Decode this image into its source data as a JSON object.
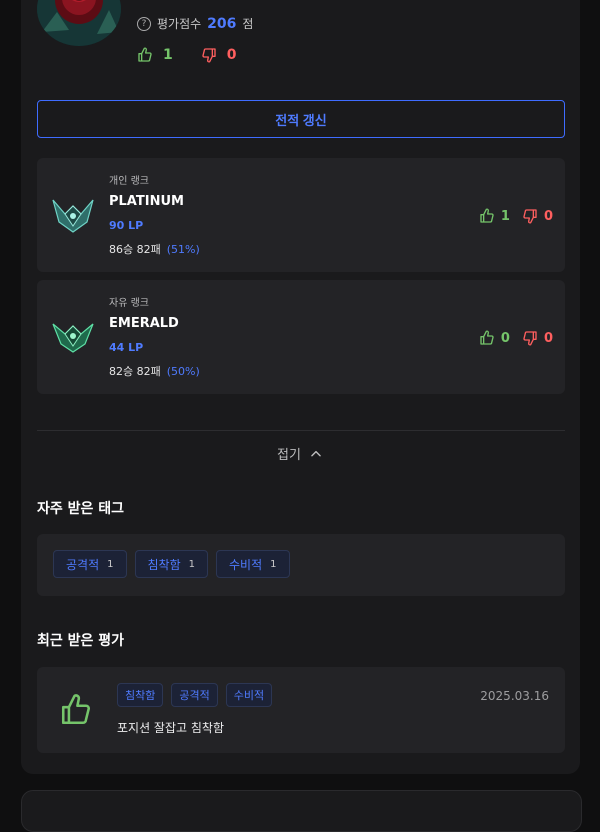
{
  "profile": {
    "score_label": "평가점수",
    "score_value": "206",
    "score_unit": "점",
    "likes": "1",
    "dislikes": "0"
  },
  "refresh_button": "전적 갱신",
  "ranks": [
    {
      "queue": "개인 랭크",
      "tier": "PLATINUM",
      "lp": "90 LP",
      "record": "86승 82패",
      "winrate": "(51%)",
      "likes": "1",
      "dislikes": "0",
      "emblem_color": "#4ea7a0"
    },
    {
      "queue": "자유 랭크",
      "tier": "EMERALD",
      "lp": "44 LP",
      "record": "82승 82패",
      "winrate": "(50%)",
      "likes": "0",
      "dislikes": "0",
      "emblem_color": "#3fb27c"
    }
  ],
  "fold_label": "접기",
  "tags_section": {
    "title": "자주 받은 태그",
    "tags": [
      {
        "label": "공격적",
        "count": "1"
      },
      {
        "label": "침착함",
        "count": "1"
      },
      {
        "label": "수비적",
        "count": "1"
      }
    ]
  },
  "reviews_section": {
    "title": "최근 받은 평가",
    "items": [
      {
        "tags": [
          "침착함",
          "공격적",
          "수비적"
        ],
        "text": "포지션 잘잡고 침착함",
        "date": "2025.03.16"
      }
    ]
  },
  "colors": {
    "accent": "#4f7bff",
    "like": "#75c46a",
    "dislike": "#ff5f5f"
  }
}
